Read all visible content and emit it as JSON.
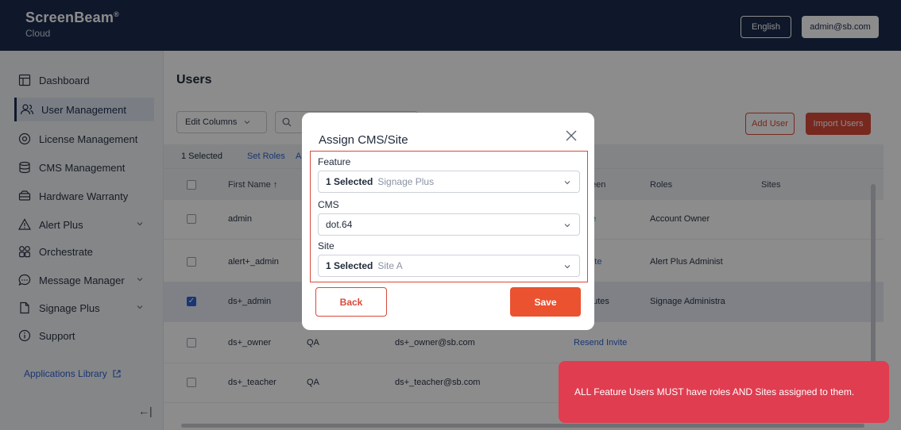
{
  "header": {
    "brand": "ScreenBeam",
    "brand_mark": "®",
    "brand_sub": "Cloud",
    "language": "English",
    "user": "admin@sb.com"
  },
  "sidebar": {
    "items": [
      {
        "label": "Dashboard",
        "icon": "dashboard-icon"
      },
      {
        "label": "User Management",
        "icon": "users-icon",
        "active": true
      },
      {
        "label": "License Management",
        "icon": "license-icon"
      },
      {
        "label": "CMS Management",
        "icon": "database-icon"
      },
      {
        "label": "Hardware Warranty",
        "icon": "warranty-icon"
      },
      {
        "label": "Alert Plus",
        "icon": "alert-icon",
        "expandable": true
      },
      {
        "label": "Orchestrate",
        "icon": "grid-icon"
      },
      {
        "label": "Message Manager",
        "icon": "message-icon",
        "expandable": true
      },
      {
        "label": "Signage Plus",
        "icon": "file-icon",
        "expandable": true
      },
      {
        "label": "Support",
        "icon": "info-icon"
      }
    ],
    "apps_link": "Applications Library",
    "collapse_glyph": "←|"
  },
  "page": {
    "title": "Users",
    "edit_columns": "Edit Columns",
    "add_user": "Add User",
    "import_users": "Import Users",
    "selection": {
      "count": "1 Selected",
      "set_roles": "Set Roles",
      "more": "A"
    },
    "columns": [
      "First Name ↑",
      "een",
      "Roles",
      "Sites"
    ],
    "rows": [
      {
        "first": "admin",
        "last": "",
        "email": "",
        "status": "e",
        "role": "Account Owner",
        "checked": false
      },
      {
        "first": "alert+_admin",
        "last": "",
        "email": "",
        "status": "d Invite",
        "role": "Alert Plus Administ",
        "checked": false
      },
      {
        "first": "ds+_admin",
        "last": "",
        "email": "",
        "status": "nutes",
        "role": "Signage Administra",
        "checked": true
      },
      {
        "first": "ds+_owner",
        "last": "QA",
        "email": "ds+_owner@sb.com",
        "status": "Resend Invite",
        "role": "",
        "checked": false
      },
      {
        "first": "ds+_teacher",
        "last": "QA",
        "email": "ds+_teacher@sb.com",
        "status": "",
        "role": "",
        "checked": false
      }
    ]
  },
  "modal": {
    "title": "Assign CMS/Site",
    "feature_label": "Feature",
    "feature_count": "1 Selected",
    "feature_value": "Signage Plus",
    "cms_label": "CMS",
    "cms_value": "dot.64",
    "site_label": "Site",
    "site_count": "1 Selected",
    "site_value": "Site A",
    "back": "Back",
    "save": "Save"
  },
  "toast": {
    "message": "ALL Feature Users MUST have roles AND Sites assigned to them."
  },
  "colors": {
    "nav": "#1d2c4e",
    "accent": "#d9493a",
    "save": "#ea5230",
    "toast": "#e03d50",
    "link": "#2f62d4"
  }
}
